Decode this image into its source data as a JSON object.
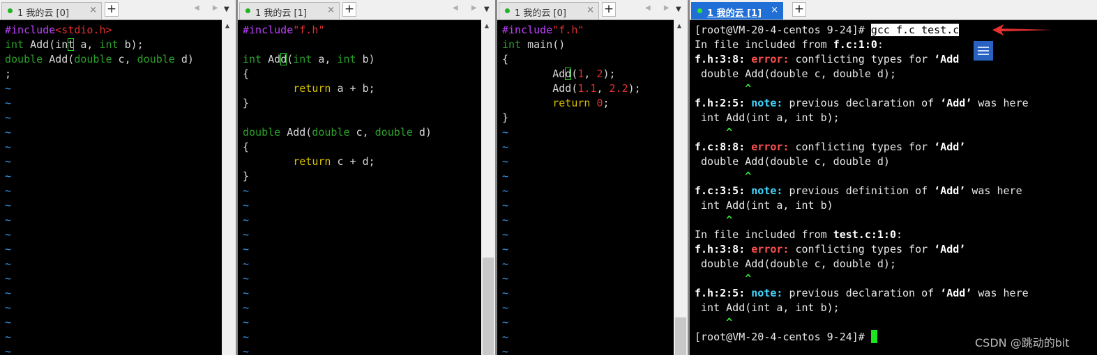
{
  "panes": [
    {
      "tab": {
        "title": "1 我的云 [0]",
        "close": "×"
      },
      "nav": "◀ ▶",
      "menu": "▼",
      "plus": "+",
      "lines": [
        {
          "s": [
            [
              "#include",
              "pp"
            ],
            [
              "<stdio.h>",
              "str"
            ]
          ]
        },
        {
          "s": [
            [
              "int",
              "type"
            ],
            [
              " Add(",
              ""
            ],
            [
              "in",
              ""
            ],
            [
              "t",
              "cur"
            ],
            [
              " a, ",
              ""
            ],
            [
              "int",
              "type"
            ],
            [
              " b);",
              ""
            ]
          ]
        },
        {
          "s": [
            [
              "double",
              "type"
            ],
            [
              " Add(",
              ""
            ],
            [
              "double",
              "type"
            ],
            [
              " c, ",
              ""
            ],
            [
              "double",
              "type"
            ],
            [
              " d)",
              ""
            ]
          ]
        },
        {
          "s": [
            [
              ";",
              ""
            ]
          ]
        },
        {
          "s": [
            [
              "~",
              "tilde"
            ]
          ]
        },
        {
          "s": [
            [
              "~",
              "tilde"
            ]
          ]
        },
        {
          "s": [
            [
              "~",
              "tilde"
            ]
          ]
        },
        {
          "s": [
            [
              "~",
              "tilde"
            ]
          ]
        },
        {
          "s": [
            [
              "~",
              "tilde"
            ]
          ]
        },
        {
          "s": [
            [
              "~",
              "tilde"
            ]
          ]
        },
        {
          "s": [
            [
              "~",
              "tilde"
            ]
          ]
        },
        {
          "s": [
            [
              "~",
              "tilde"
            ]
          ]
        },
        {
          "s": [
            [
              "~",
              "tilde"
            ]
          ]
        },
        {
          "s": [
            [
              "~",
              "tilde"
            ]
          ]
        },
        {
          "s": [
            [
              "~",
              "tilde"
            ]
          ]
        },
        {
          "s": [
            [
              "~",
              "tilde"
            ]
          ]
        },
        {
          "s": [
            [
              "~",
              "tilde"
            ]
          ]
        },
        {
          "s": [
            [
              "~",
              "tilde"
            ]
          ]
        },
        {
          "s": [
            [
              "~",
              "tilde"
            ]
          ]
        },
        {
          "s": [
            [
              "~",
              "tilde"
            ]
          ]
        },
        {
          "s": [
            [
              "~",
              "tilde"
            ]
          ]
        },
        {
          "s": [
            [
              "~",
              "tilde"
            ]
          ]
        },
        {
          "s": [
            [
              "~",
              "tilde"
            ]
          ]
        }
      ]
    },
    {
      "tab": {
        "title": "1 我的云 [1]",
        "close": "×"
      },
      "nav": "◀ ▶",
      "menu": "▼",
      "plus": "+",
      "lines": [
        {
          "s": [
            [
              "#include",
              "pp"
            ],
            [
              "\"f.h\"",
              "str"
            ]
          ]
        },
        {
          "s": [
            [
              "",
              ""
            ]
          ]
        },
        {
          "s": [
            [
              "int",
              "type"
            ],
            [
              " Ad",
              ""
            ],
            [
              "d",
              "cur"
            ],
            [
              "(",
              ""
            ],
            [
              "int",
              "type"
            ],
            [
              " a, ",
              ""
            ],
            [
              "int",
              "type"
            ],
            [
              " b)",
              ""
            ]
          ]
        },
        {
          "s": [
            [
              "{",
              ""
            ]
          ]
        },
        {
          "s": [
            [
              "        ",
              ""
            ],
            [
              "return",
              "ret"
            ],
            [
              " a + b;",
              ""
            ]
          ]
        },
        {
          "s": [
            [
              "}",
              ""
            ]
          ]
        },
        {
          "s": [
            [
              "",
              ""
            ]
          ]
        },
        {
          "s": [
            [
              "double",
              "type"
            ],
            [
              " Add(",
              ""
            ],
            [
              "double",
              "type"
            ],
            [
              " c, ",
              ""
            ],
            [
              "double",
              "type"
            ],
            [
              " d)",
              ""
            ]
          ]
        },
        {
          "s": [
            [
              "{",
              ""
            ]
          ]
        },
        {
          "s": [
            [
              "        ",
              ""
            ],
            [
              "return",
              "ret"
            ],
            [
              " c + d;",
              ""
            ]
          ]
        },
        {
          "s": [
            [
              "}",
              ""
            ]
          ]
        },
        {
          "s": [
            [
              "~",
              "tilde"
            ]
          ]
        },
        {
          "s": [
            [
              "~",
              "tilde"
            ]
          ]
        },
        {
          "s": [
            [
              "~",
              "tilde"
            ]
          ]
        },
        {
          "s": [
            [
              "~",
              "tilde"
            ]
          ]
        },
        {
          "s": [
            [
              "~",
              "tilde"
            ]
          ]
        },
        {
          "s": [
            [
              "~",
              "tilde"
            ]
          ]
        },
        {
          "s": [
            [
              "~",
              "tilde"
            ]
          ]
        },
        {
          "s": [
            [
              "~",
              "tilde"
            ]
          ]
        },
        {
          "s": [
            [
              "~",
              "tilde"
            ]
          ]
        },
        {
          "s": [
            [
              "~",
              "tilde"
            ]
          ]
        },
        {
          "s": [
            [
              "~",
              "tilde"
            ]
          ]
        },
        {
          "s": [
            [
              "~",
              "tilde"
            ]
          ]
        }
      ]
    },
    {
      "tab": {
        "title": "1 我的云 [0]",
        "close": "×"
      },
      "nav": "◀ ▶",
      "menu": "▼",
      "plus": "+",
      "lines": [
        {
          "s": [
            [
              "#include",
              "pp"
            ],
            [
              "\"f.h\"",
              "str"
            ]
          ]
        },
        {
          "s": [
            [
              "int",
              "type"
            ],
            [
              " main()",
              ""
            ]
          ]
        },
        {
          "s": [
            [
              "{",
              ""
            ]
          ]
        },
        {
          "s": [
            [
              "        Ad",
              ""
            ],
            [
              "d",
              "cur"
            ],
            [
              "(",
              ""
            ],
            [
              "1",
              "num"
            ],
            [
              ", ",
              ""
            ],
            [
              "2",
              "num"
            ],
            [
              ");",
              ""
            ]
          ]
        },
        {
          "s": [
            [
              "        Add(",
              ""
            ],
            [
              "1.1",
              "num"
            ],
            [
              ", ",
              ""
            ],
            [
              "2.2",
              "num"
            ],
            [
              ");",
              ""
            ]
          ]
        },
        {
          "s": [
            [
              "        ",
              ""
            ],
            [
              "return",
              "ret"
            ],
            [
              " ",
              ""
            ],
            [
              "0",
              "num"
            ],
            [
              ";",
              ""
            ]
          ]
        },
        {
          "s": [
            [
              "}",
              ""
            ]
          ]
        },
        {
          "s": [
            [
              "~",
              "tilde"
            ]
          ]
        },
        {
          "s": [
            [
              "~",
              "tilde"
            ]
          ]
        },
        {
          "s": [
            [
              "~",
              "tilde"
            ]
          ]
        },
        {
          "s": [
            [
              "~",
              "tilde"
            ]
          ]
        },
        {
          "s": [
            [
              "~",
              "tilde"
            ]
          ]
        },
        {
          "s": [
            [
              "~",
              "tilde"
            ]
          ]
        },
        {
          "s": [
            [
              "~",
              "tilde"
            ]
          ]
        },
        {
          "s": [
            [
              "~",
              "tilde"
            ]
          ]
        },
        {
          "s": [
            [
              "~",
              "tilde"
            ]
          ]
        },
        {
          "s": [
            [
              "~",
              "tilde"
            ]
          ]
        },
        {
          "s": [
            [
              "~",
              "tilde"
            ]
          ]
        },
        {
          "s": [
            [
              "~",
              "tilde"
            ]
          ]
        },
        {
          "s": [
            [
              "~",
              "tilde"
            ]
          ]
        },
        {
          "s": [
            [
              "~",
              "tilde"
            ]
          ]
        },
        {
          "s": [
            [
              "~",
              "tilde"
            ]
          ]
        },
        {
          "s": [
            [
              "~",
              "tilde"
            ]
          ]
        }
      ]
    },
    {
      "tab": {
        "title": "1 我的云 [1]",
        "close": "×"
      },
      "plus": "+",
      "lines": [
        {
          "s": [
            [
              "[root@VM-20-4-centos 9-24]# ",
              ""
            ],
            [
              "gcc f.c test.c",
              "cmdhl"
            ]
          ]
        },
        {
          "s": [
            [
              "In file included from ",
              ""
            ],
            [
              "f.c:1:0",
              "b"
            ],
            [
              ":",
              ""
            ]
          ]
        },
        {
          "s": [
            [
              "f.h:3:8:",
              "b"
            ],
            [
              " ",
              ""
            ],
            [
              "error:",
              "err"
            ],
            [
              " conflicting types for ",
              ""
            ],
            [
              "‘Add",
              "b"
            ]
          ]
        },
        {
          "s": [
            [
              " double Add(double c, double d);",
              ""
            ]
          ]
        },
        {
          "s": [
            [
              "        ",
              ""
            ],
            [
              "^",
              "caret"
            ]
          ]
        },
        {
          "s": [
            [
              "f.h:2:5:",
              "b"
            ],
            [
              " ",
              ""
            ],
            [
              "note:",
              "note"
            ],
            [
              " previous declaration of ",
              ""
            ],
            [
              "‘Add’",
              "b"
            ],
            [
              " was here",
              ""
            ]
          ]
        },
        {
          "s": [
            [
              " int Add(int a, int b);",
              ""
            ]
          ]
        },
        {
          "s": [
            [
              "     ",
              ""
            ],
            [
              "^",
              "caret"
            ]
          ]
        },
        {
          "s": [
            [
              "f.c:8:8:",
              "b"
            ],
            [
              " ",
              ""
            ],
            [
              "error:",
              "err"
            ],
            [
              " conflicting types for ",
              ""
            ],
            [
              "‘Add’",
              "b"
            ]
          ]
        },
        {
          "s": [
            [
              " double Add(double c, double d)",
              ""
            ]
          ]
        },
        {
          "s": [
            [
              "        ",
              ""
            ],
            [
              "^",
              "caret"
            ]
          ]
        },
        {
          "s": [
            [
              "f.c:3:5:",
              "b"
            ],
            [
              " ",
              ""
            ],
            [
              "note:",
              "note"
            ],
            [
              " previous definition of ",
              ""
            ],
            [
              "‘Add’",
              "b"
            ],
            [
              " was here",
              ""
            ]
          ]
        },
        {
          "s": [
            [
              " int Add(int a, int b)",
              ""
            ]
          ]
        },
        {
          "s": [
            [
              "     ",
              ""
            ],
            [
              "^",
              "caret"
            ]
          ]
        },
        {
          "s": [
            [
              "In file included from ",
              ""
            ],
            [
              "test.c:1:0",
              "b"
            ],
            [
              ":",
              ""
            ]
          ]
        },
        {
          "s": [
            [
              "f.h:3:8:",
              "b"
            ],
            [
              " ",
              ""
            ],
            [
              "error:",
              "err"
            ],
            [
              " conflicting types for ",
              ""
            ],
            [
              "‘Add’",
              "b"
            ]
          ]
        },
        {
          "s": [
            [
              " double Add(double c, double d);",
              ""
            ]
          ]
        },
        {
          "s": [
            [
              "        ",
              ""
            ],
            [
              "^",
              "caret"
            ]
          ]
        },
        {
          "s": [
            [
              "f.h:2:5:",
              "b"
            ],
            [
              " ",
              ""
            ],
            [
              "note:",
              "note"
            ],
            [
              " previous declaration of ",
              ""
            ],
            [
              "‘Add’",
              "b"
            ],
            [
              " was here",
              ""
            ]
          ]
        },
        {
          "s": [
            [
              " int Add(int a, int b);",
              ""
            ]
          ]
        },
        {
          "s": [
            [
              "     ",
              ""
            ],
            [
              "^",
              "caret"
            ]
          ]
        },
        {
          "s": [
            [
              "[root@VM-20-4-centos 9-24]# ",
              ""
            ]
          ],
          "cursor": true
        }
      ]
    }
  ],
  "watermark": "CSDN @跳动的bit",
  "colors": {
    "accent": "#1f6fd6",
    "error": "#ff5050",
    "note": "#40d8ff",
    "caret": "#2fe02f",
    "tilde": "#3a9cf0"
  }
}
